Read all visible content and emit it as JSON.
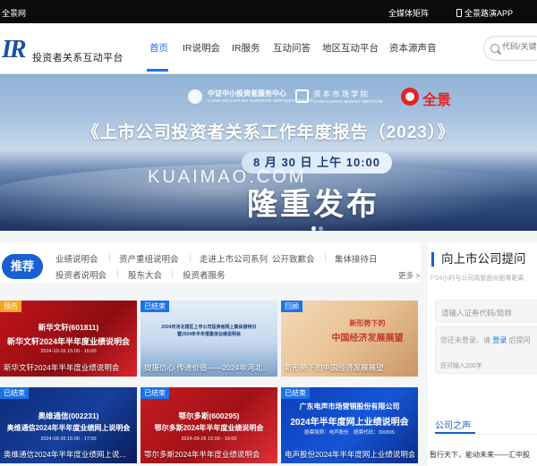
{
  "topbar": {
    "left": "全景网",
    "media_matrix": "全媒体矩阵",
    "app": "全景路演APP"
  },
  "header": {
    "logo_mark": "IR",
    "logo_text": "投资者关系互动平台",
    "nav": [
      "首页",
      "IR说明会",
      "IR服务",
      "互动问答",
      "地区互动平台",
      "资本源声音"
    ],
    "active_nav": "首页",
    "search_placeholder": "代码/关键词"
  },
  "banner": {
    "sponsor1_name": "中证中小投资者服务中心",
    "sponsor1_en": "CHINA SECURITIES INVESTOR SERVICES CENTER",
    "sponsor2_name": "资本市场学院",
    "sponsor2_en": "CHINA CAPITAL MARKET INSTITUTE",
    "sponsor3_name": "全景",
    "title": "《上市公司投资者关系工作年度报告（2023）》",
    "date": "8 月 30 日 上午 10:00",
    "headline": "隆重发布",
    "watermark": "KUAIMAO.COM"
  },
  "recommend": {
    "button": "推荐",
    "row1": [
      "业绩说明会",
      "资产重组说明会",
      "走进上市公司系列",
      "公开致歉会",
      "集体接待日"
    ],
    "row2": [
      "投资者说明会",
      "股东大会",
      "投资者服务"
    ],
    "more": "更多 >"
  },
  "cards": [
    {
      "tag": "预告",
      "tag_color": "#f5a623",
      "line1": "新华文轩(601811)",
      "line2": "新华文轩2024年半年度业绩说明会",
      "line3": "2024-10-16 15:00 - 16:00",
      "caption": "新华文轩2024年半年度业绩说明会"
    },
    {
      "tag": "已结束",
      "tag_color": "#1a73e8",
      "line1": "2024年河北辖区上市公司投资者网上集体接待日",
      "line2": "暨2024年半年报集体业绩说明会",
      "line3": "",
      "caption": "提振信心 传递价值——2024年河北..."
    },
    {
      "tag": "回顾",
      "tag_color": "#1a73e8",
      "line1": "新形势下的",
      "line2": "中国经济发展展望",
      "line3": "",
      "caption": "新形势下的中国经济发展展望"
    },
    {
      "tag": "已结束",
      "tag_color": "#1a73e8",
      "line1": "奥维通信(002231)",
      "line2": "奥维通信2024年半年度业绩网上说明会",
      "line3": "2024-09-26 15:00 - 17:00",
      "caption": "奥维通信2024年半年度业绩网上说..."
    },
    {
      "tag": "已结束",
      "tag_color": "#1a73e8",
      "line1": "鄂尔多斯(600295)",
      "line2": "鄂尔多斯2024年半年度业绩说明会",
      "line3": "2024-09-26 15:00 - 16:00",
      "caption": "鄂尔多斯2024年半年度业绩说明会"
    },
    {
      "tag": "已结束",
      "tag_color": "#1a73e8",
      "line1": "广东电声市场营销股份有限公司",
      "line2": "2024年半年度网上业绩说明会",
      "line3": "股票简称：电声股份　股票代码：300805",
      "caption": "电声股份2024年半年度网上业绩说明会"
    }
  ],
  "sidebar": {
    "title": "向上市公司提问",
    "subtitle": "7*24小时与公司高管面对面零距离",
    "code_placeholder": "请输入证券代码/简称",
    "login_prefix": "您还未登录，请",
    "login_link": "登录",
    "login_suffix": "后提问",
    "remaining": "还可输入200字",
    "voice_title": "公司之声",
    "quote": "暂行天下，能动未来——汇中股"
  },
  "colors": {
    "primary": "#1a5fd1",
    "nav_active": "#1a73e8",
    "topbar": "#0b0b0b",
    "tag_orange": "#f5a623",
    "tag_blue": "#1a73e8"
  }
}
